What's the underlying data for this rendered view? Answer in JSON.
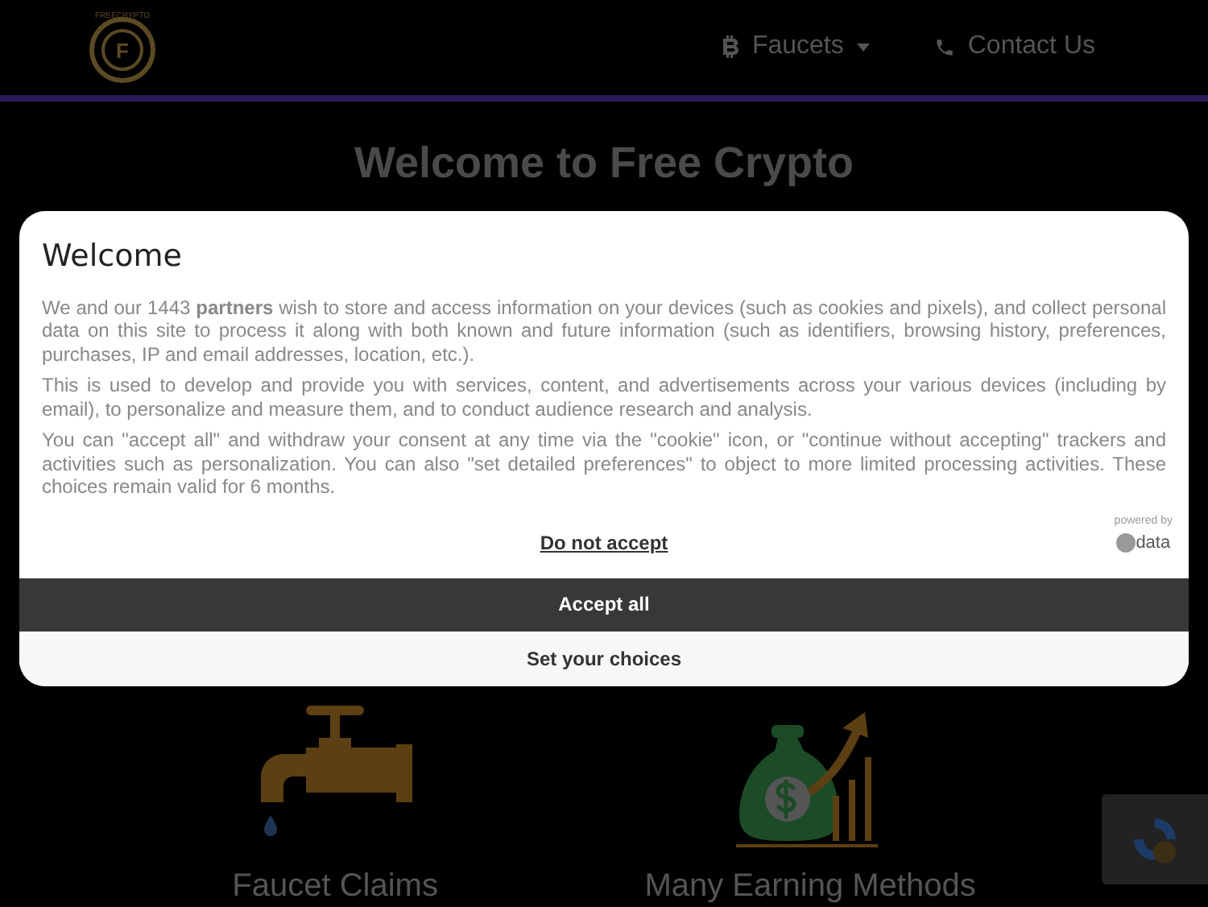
{
  "header": {
    "logo_ring_text": "FREECRYPTO",
    "logo_letter": "F",
    "nav": [
      {
        "kind": "bitcoin",
        "label": "Faucets",
        "dropdown": true
      },
      {
        "kind": "phone",
        "label": "Contact Us",
        "dropdown": false
      }
    ]
  },
  "title": "Welcome to Free Crypto",
  "consent": {
    "heading": "Welcome",
    "paragraphs": [
      "We and our 1443 **partners** wish to store and access information on your devices (such as cookies and pixels), and collect personal data on this site to process it along with both known and future information (such as identifiers, browsing history, preferences, purchases, IP and email addresses, location, etc.).",
      "This is used to develop and provide you with services, content, and advertisements across your various devices (including by email), to personalize and measure them, and to conduct audience research and analysis.",
      "You can \"accept all\" and withdraw your consent at any time via the \"cookie\" icon, or \"continue without accepting\" trackers and activities such as personalization. You can also \"set detailed preferences\" to object to more limited processing activities. These choices remain valid for 6 months."
    ],
    "reject": "Do not accept",
    "powered_by": "powered by",
    "brand": "data",
    "accept": "Accept all",
    "choices": "Set your choices"
  },
  "features": [
    {
      "kind": "faucet",
      "label": "Faucet Claims"
    },
    {
      "kind": "money",
      "label": "Many Earning Methods"
    }
  ]
}
